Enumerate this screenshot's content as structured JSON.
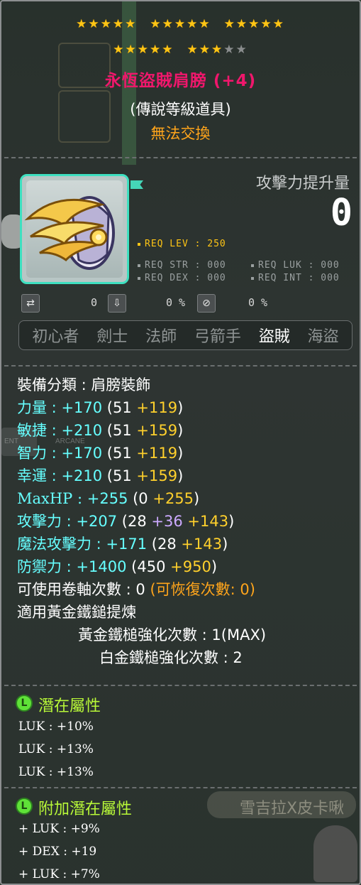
{
  "stars": {
    "row1": [
      [
        1,
        1,
        1,
        1,
        1
      ],
      [
        1,
        1,
        1,
        1,
        1
      ],
      [
        1,
        1,
        1,
        1,
        1
      ]
    ],
    "row2": [
      [
        1,
        1,
        1,
        1,
        1
      ],
      [
        1,
        1,
        1,
        0,
        0
      ]
    ],
    "glyph": "★"
  },
  "item": {
    "name": "永恆盜賊肩膀 (+4)",
    "grade": "(傳說等級道具)",
    "trade": "無法交換"
  },
  "attack_power_increase": {
    "label": "攻擊力提升量",
    "value": "0"
  },
  "requirements": {
    "lev": "REQ LEV : 250",
    "str": "REQ STR : 000",
    "dex": "REQ DEX : 000",
    "luk": "REQ LUK : 000",
    "int": "REQ INT : 000"
  },
  "icon_row": {
    "v1": "0",
    "v2": "0 %",
    "v3": "0 %"
  },
  "jobs": [
    "初心者",
    "劍士",
    "法師",
    "弓箭手",
    "盜賊",
    "海盜"
  ],
  "active_job": "盜賊",
  "stats": {
    "category": "裝備分類 : 肩膀裝飾",
    "str": {
      "label": "力量 : ",
      "total": "+170",
      "open": " (51 ",
      "bonus": "+119",
      "close": ")"
    },
    "dex": {
      "label": "敏捷 : ",
      "total": "+210",
      "open": " (51 ",
      "bonus": "+159",
      "close": ")"
    },
    "int": {
      "label": "智力 : ",
      "total": "+170",
      "open": " (51 ",
      "bonus": "+119",
      "close": ")"
    },
    "luk": {
      "label": "幸運 : ",
      "total": "+210",
      "open": " (51 ",
      "bonus": "+159",
      "close": ")"
    },
    "maxhp": {
      "label": "MaxHP : ",
      "total": "+255",
      "open": " (0 ",
      "bonus": "+255",
      "close": ")"
    },
    "att": {
      "label": "攻擊力 : ",
      "total": "+207",
      "open": " (28 ",
      "extra": "+36",
      "bonus": "+143",
      "close": ")"
    },
    "matt": {
      "label": "魔法攻擊力 : ",
      "total": "+171",
      "open": " (28 ",
      "bonus": "+143",
      "close": ")"
    },
    "def": {
      "label": "防禦力 : ",
      "total": "+1400",
      "open": " (450 ",
      "bonus": "+950",
      "close": ")"
    },
    "upgrades": "可使用卷軸次數 : 0 ",
    "recover": "(可恢復次數: 0)",
    "hammer": "適用黃金鐵鎚提煉",
    "golden": "黃金鐵槌強化次數 : 1(MAX)",
    "platinum": "白金鐵槌強化次數 : 2"
  },
  "potential": {
    "title": "潛在屬性",
    "lines": [
      "LUK : +10%",
      "LUK : +13%",
      "LUK : +13%"
    ]
  },
  "additional": {
    "title": "附加潛在屬性",
    "lines": [
      "+ LUK : +9%",
      "+ DEX : +19",
      "+ LUK : +7%"
    ]
  },
  "background_texts": {
    "user_name": "雪吉拉X皮卡啾",
    "arcane": "ARCANE",
    "ent": "ENT"
  },
  "colors": {
    "title": "#f0176c",
    "trade": "#ffa51b",
    "stat_blue": "#66ffff",
    "stat_yellow": "#ffd02c",
    "stat_purple": "#ccaaff",
    "potential_green": "#b8f838",
    "frame_teal": "#3ee0c0"
  }
}
